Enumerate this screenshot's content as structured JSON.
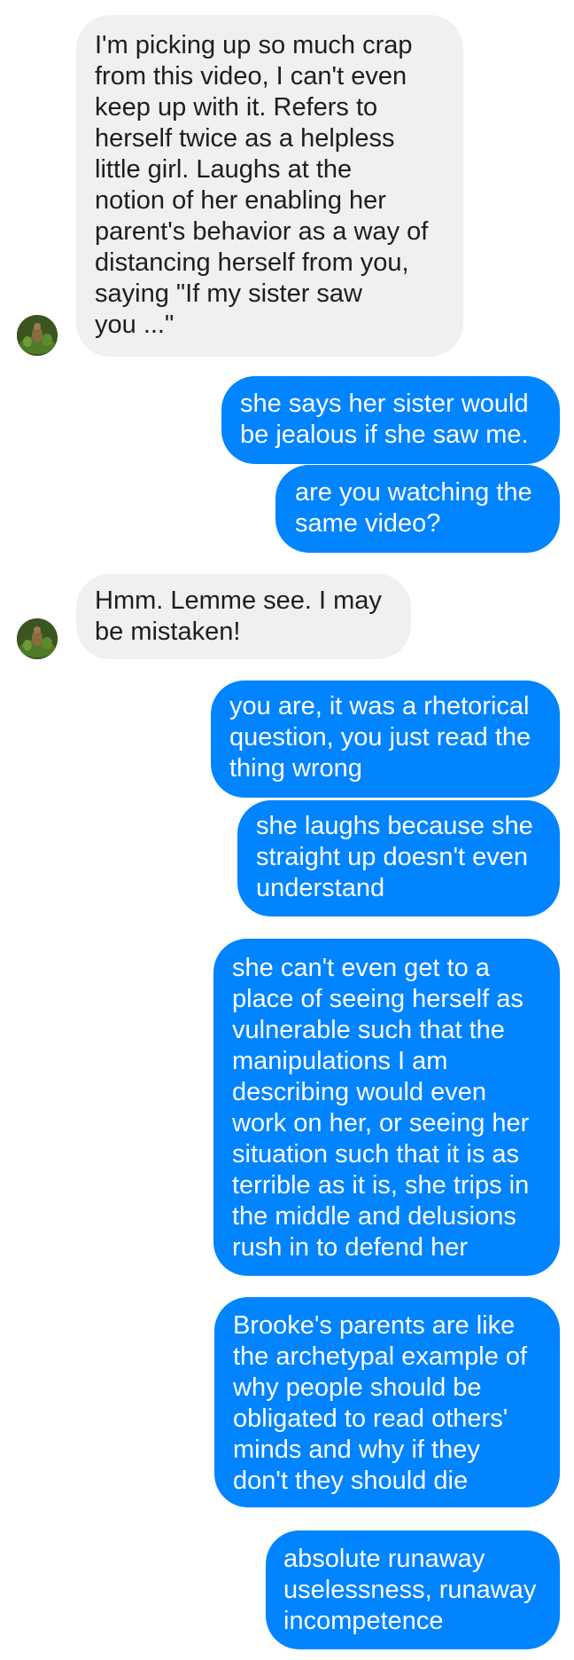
{
  "colors": {
    "incoming_bubble": "#f1f0f0",
    "outgoing_bubble": "#0084ff",
    "incoming_text": "#1c1e21",
    "outgoing_text": "#ffffff"
  },
  "messages": [
    {
      "sender": "contact",
      "text": "I'm picking up so much crap\nfrom this video, I can't even\nkeep up with it. Refers to\nherself twice as a helpless\nlittle girl. Laughs at the\nnotion of her enabling her\nparent's behavior as a way of\ndistancing herself from you,\nsaying \"If my sister saw\nyou ...\""
    },
    {
      "sender": "me",
      "text": "she says her sister would\nbe jealous if she saw me."
    },
    {
      "sender": "me",
      "text": "are you watching the\nsame video?"
    },
    {
      "sender": "contact",
      "text": "Hmm. Lemme see. I may\nbe mistaken!"
    },
    {
      "sender": "me",
      "text": "you are, it was a rhetorical\nquestion, you just read the\nthing wrong"
    },
    {
      "sender": "me",
      "text": "she laughs because she\nstraight up doesn't even\nunderstand"
    },
    {
      "sender": "me",
      "text": "she can't even get to a\nplace of seeing herself as\nvulnerable such that the\nmanipulations I am\ndescribing would even\nwork on her, or seeing her\nsituation such that it is as\nterrible as it is, she trips in\nthe middle and delusions\nrush in to defend her"
    },
    {
      "sender": "me",
      "text": "Brooke's parents are like\nthe archetypal example of\nwhy people should be\nobligated to read others'\nminds and why if they\ndon't they should die"
    },
    {
      "sender": "me",
      "text": "absolute runaway\nuselessness, runaway\nincompetence"
    }
  ],
  "avatars": [
    {
      "icon": "contact-avatar-icon"
    },
    {
      "icon": "contact-avatar-icon"
    }
  ]
}
